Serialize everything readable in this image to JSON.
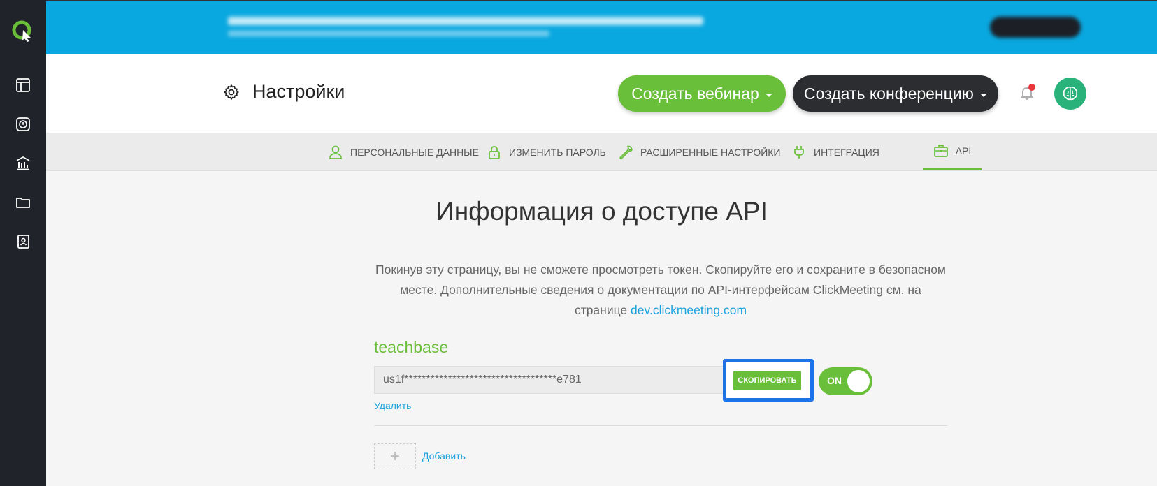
{
  "colors": {
    "accent": "#6abf3a",
    "link": "#1aa3dc",
    "sidebar": "#21232a",
    "banner": "#0aa8e0",
    "highlight": "#1a73e8"
  },
  "sidebar": {
    "items": [
      {
        "icon": "dashboard-icon"
      },
      {
        "icon": "clock-icon"
      },
      {
        "icon": "statistics-icon"
      },
      {
        "icon": "folder-icon"
      },
      {
        "icon": "contacts-icon"
      }
    ]
  },
  "header": {
    "title": "Настройки",
    "create_webinar": "Создать вебинар",
    "create_conference": "Создать конференцию"
  },
  "tabs": [
    {
      "label": "Персональные данные",
      "icon": "user-icon"
    },
    {
      "label": "Изменить пароль",
      "icon": "lock-icon"
    },
    {
      "label": "Расширенные настройки",
      "icon": "wrench-icon"
    },
    {
      "label": "Интеграция",
      "icon": "plug-icon"
    },
    {
      "label": "API",
      "icon": "api-icon",
      "active": true
    }
  ],
  "content": {
    "title": "Информация о доступе API",
    "description": "Покинув эту страницу, вы не сможете просмотреть токен. Скопируйте его и сохраните в безопасном месте. Дополнительные сведения о документации по API-интерфейсам ClickMeeting см. на странице",
    "doc_link": "dev.clickmeeting.com",
    "key_name": "teachbase",
    "token": "us1f***********************************e781",
    "copy_label": "СКОПИРОВАТЬ",
    "toggle_label": "ON",
    "delete_label": "Удалить",
    "add_label": "Добавить",
    "add_symbol": "+"
  }
}
